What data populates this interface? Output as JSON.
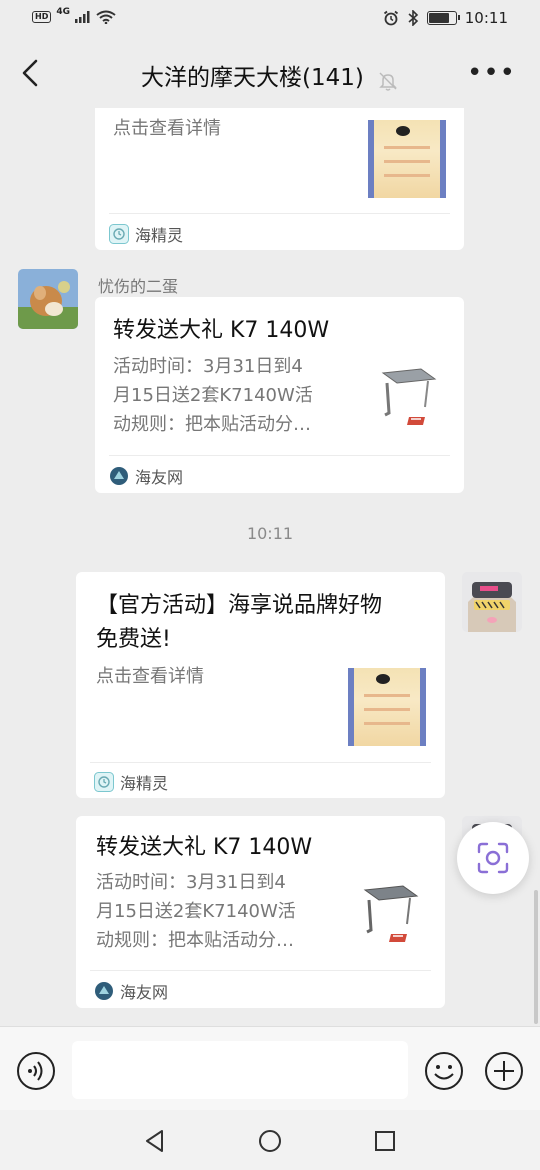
{
  "status_bar": {
    "hd_badge": "HD",
    "network": "4G",
    "time": "10:11",
    "battery_level": 0.85
  },
  "header": {
    "title": "大洋的摩天大楼(141)"
  },
  "messages": {
    "card1": {
      "desc": "点击查看详情",
      "source": "海精灵"
    },
    "card2": {
      "sender": "忧伤的二蛋",
      "title": "转发送大礼 K7 140W",
      "desc_lines": [
        "活动时间：3月31日到4",
        "月15日送2套K7140W活",
        "动规则：把本贴活动分…"
      ],
      "source": "海友网"
    },
    "timestamp": "10:11",
    "card3": {
      "title_lines": [
        "【官方活动】海享说品牌好物",
        "免费送!"
      ],
      "desc": "点击查看详情",
      "source": "海精灵"
    },
    "card4": {
      "title": "转发送大礼 K7 140W",
      "desc_lines": [
        "活动时间：3月31日到4",
        "月15日送2套K7140W活",
        "动规则：把本贴活动分…"
      ],
      "source": "海友网"
    }
  },
  "colors": {
    "background": "#ededed",
    "card": "#ffffff",
    "accent_icon": "#8a6fd6"
  }
}
